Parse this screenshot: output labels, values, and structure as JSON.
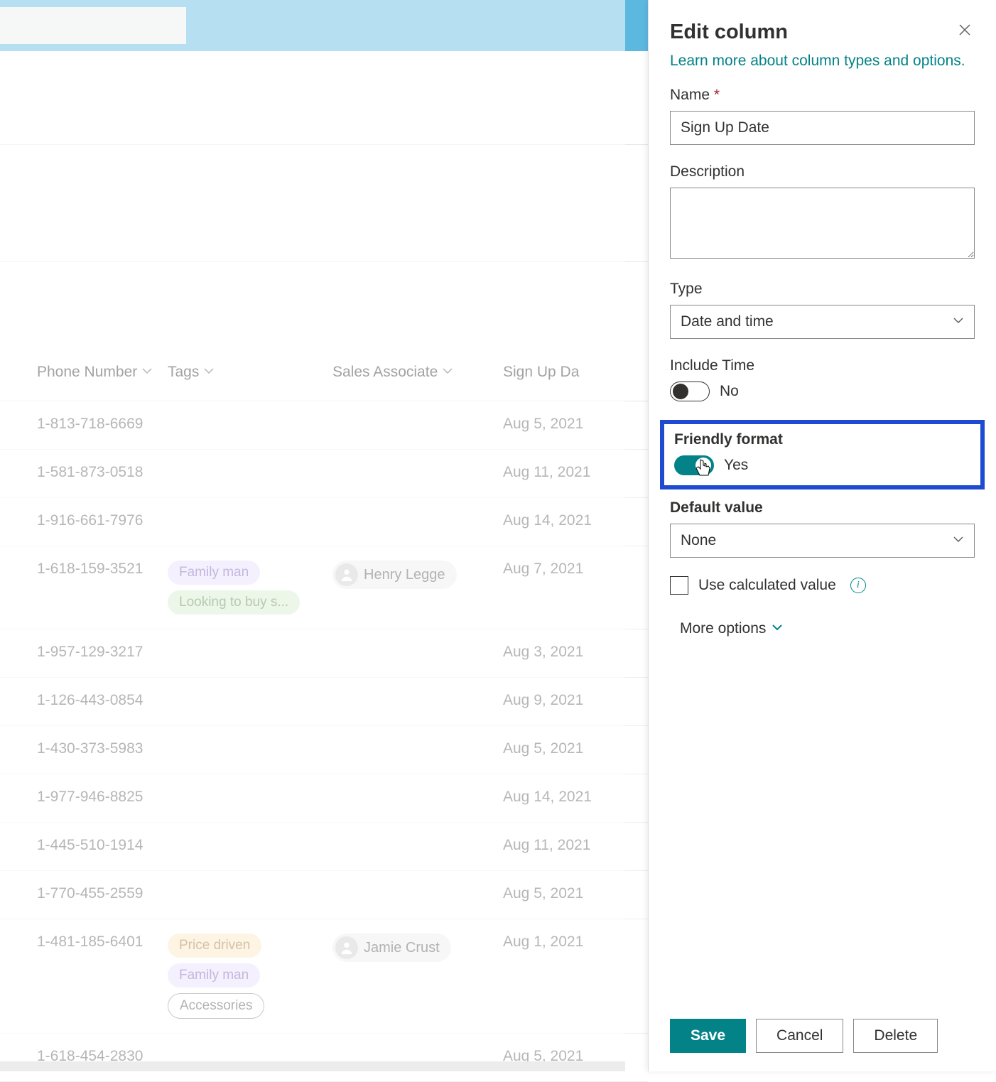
{
  "toolbar": {
    "search_placeholder": ""
  },
  "columns": {
    "phone": "Phone Number",
    "tags": "Tags",
    "assoc": "Sales Associate",
    "date": "Sign Up Da"
  },
  "rows": [
    {
      "phone": "1-813-718-6669",
      "tags": [],
      "assoc": "",
      "date": "Aug 5, 2021"
    },
    {
      "phone": "1-581-873-0518",
      "tags": [],
      "assoc": "",
      "date": "Aug 11, 2021"
    },
    {
      "phone": "1-916-661-7976",
      "tags": [],
      "assoc": "",
      "date": "Aug 14, 2021"
    },
    {
      "phone": "1-618-159-3521",
      "tags": [
        {
          "label": "Family man",
          "style": "purple"
        },
        {
          "label": "Looking to buy s...",
          "style": "green"
        }
      ],
      "assoc": "Henry Legge",
      "date": "Aug 7, 2021"
    },
    {
      "phone": "1-957-129-3217",
      "tags": [],
      "assoc": "",
      "date": "Aug 3, 2021"
    },
    {
      "phone": "1-126-443-0854",
      "tags": [],
      "assoc": "",
      "date": "Aug 9, 2021"
    },
    {
      "phone": "1-430-373-5983",
      "tags": [],
      "assoc": "",
      "date": "Aug 5, 2021"
    },
    {
      "phone": "1-977-946-8825",
      "tags": [],
      "assoc": "",
      "date": "Aug 14, 2021"
    },
    {
      "phone": "1-445-510-1914",
      "tags": [],
      "assoc": "",
      "date": "Aug 11, 2021"
    },
    {
      "phone": "1-770-455-2559",
      "tags": [],
      "assoc": "",
      "date": "Aug 5, 2021"
    },
    {
      "phone": "1-481-185-6401",
      "tags": [
        {
          "label": "Price driven",
          "style": "orange"
        },
        {
          "label": "Family man",
          "style": "purple"
        },
        {
          "label": "Accessories",
          "style": "outline"
        }
      ],
      "assoc": "Jamie Crust",
      "date": "Aug 1, 2021"
    },
    {
      "phone": "1-618-454-2830",
      "tags": [],
      "assoc": "",
      "date": "Aug 5, 2021"
    }
  ],
  "panel": {
    "title": "Edit column",
    "learn": "Learn more about column types and options.",
    "name_label": "Name",
    "name_value": "Sign Up Date",
    "desc_label": "Description",
    "desc_value": "",
    "type_label": "Type",
    "type_value": "Date and time",
    "include_time_label": "Include Time",
    "include_time_value": "No",
    "friendly_label": "Friendly format",
    "friendly_value": "Yes",
    "default_label": "Default value",
    "default_value": "None",
    "calc_label": "Use calculated value",
    "more": "More options",
    "save": "Save",
    "cancel": "Cancel",
    "delete": "Delete"
  }
}
